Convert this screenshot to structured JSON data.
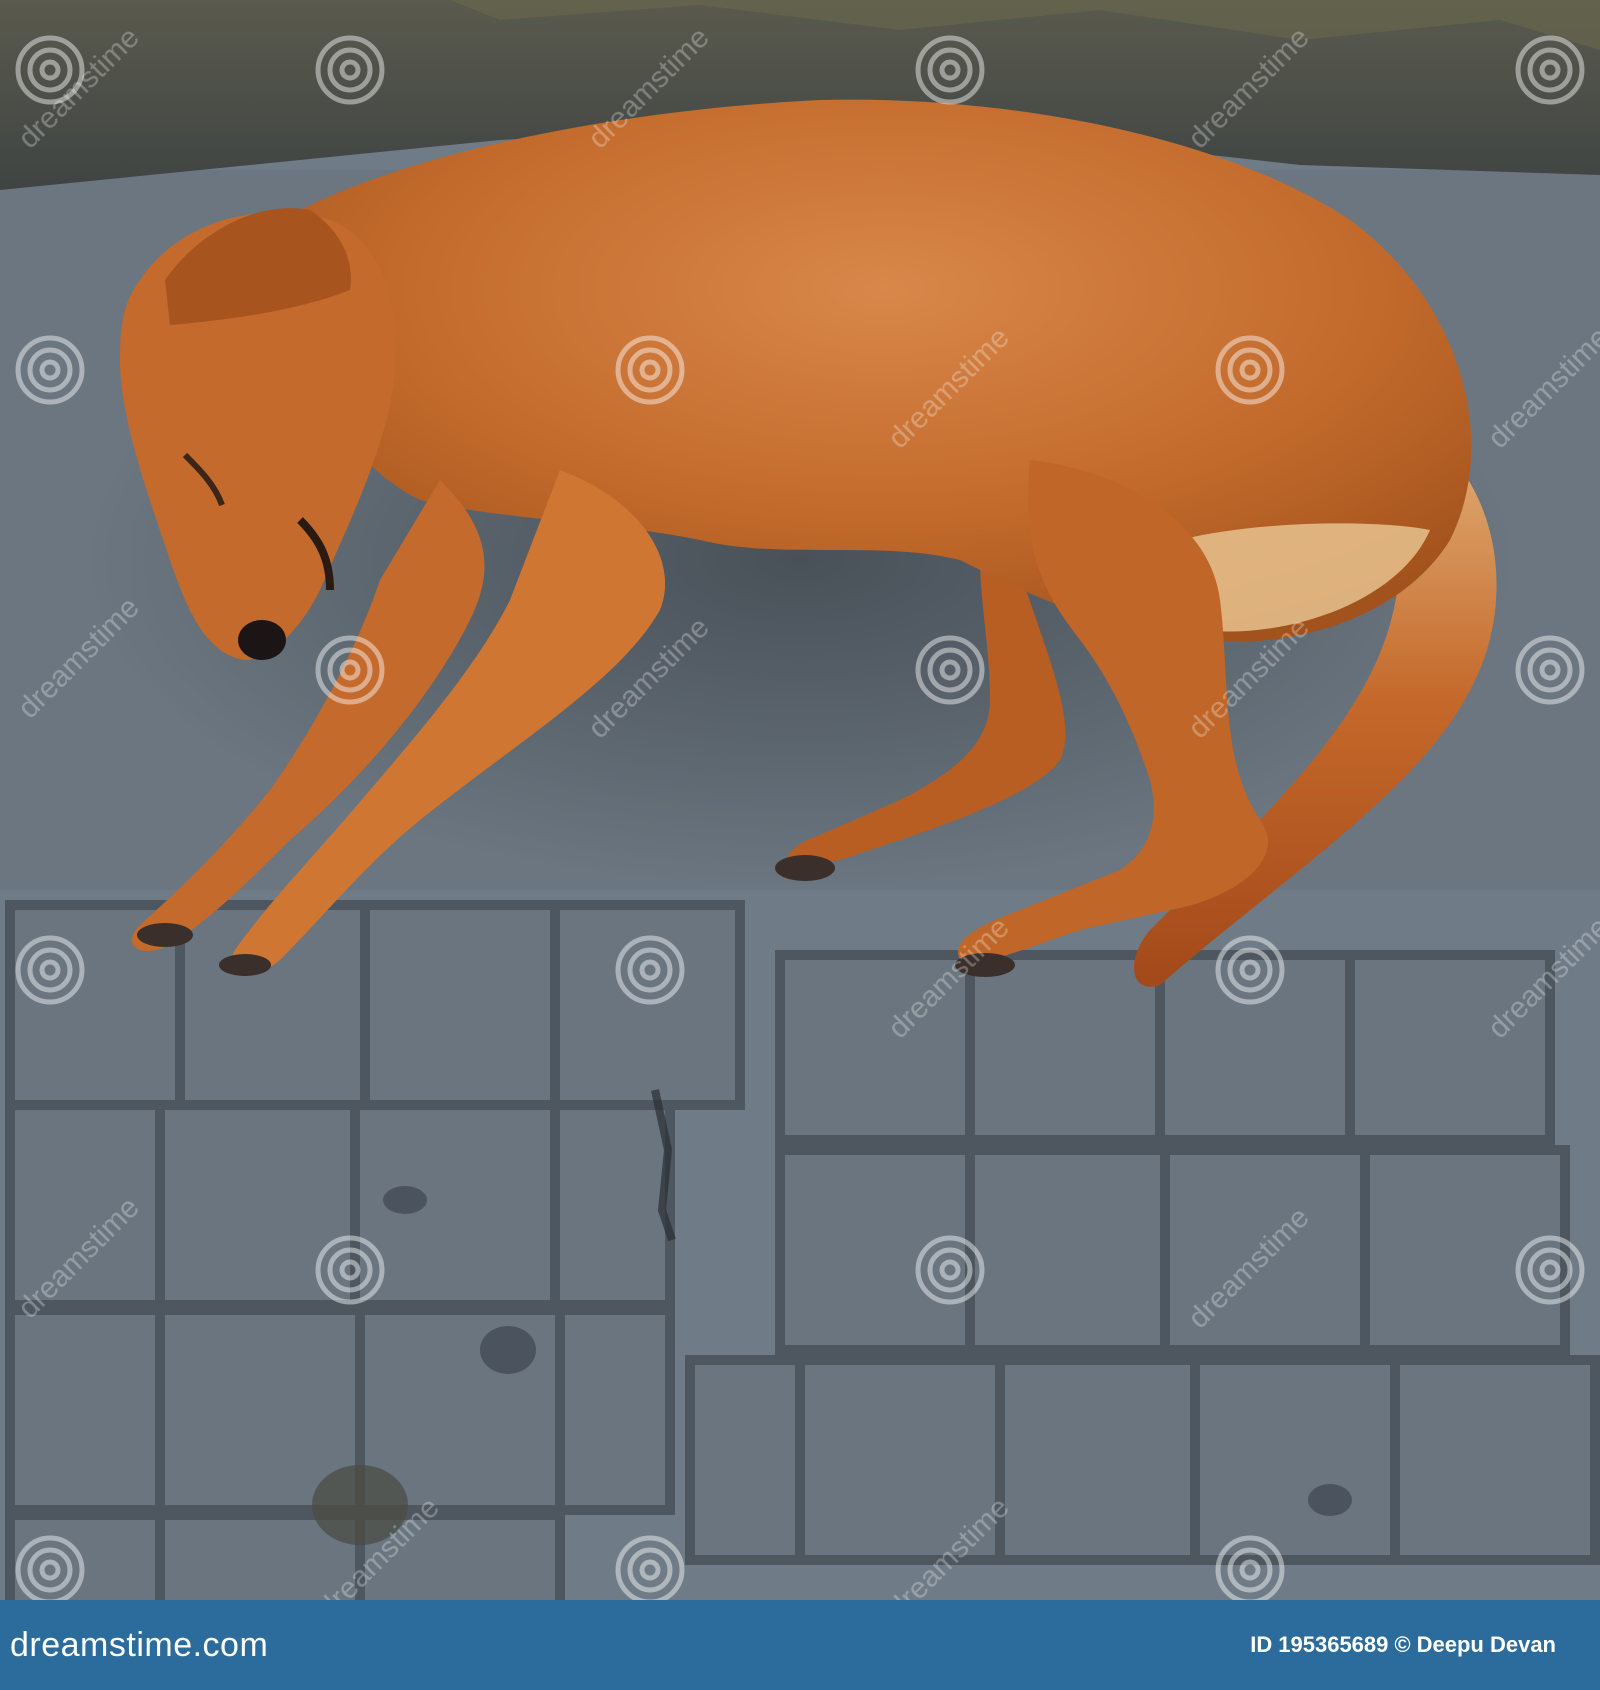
{
  "photo": {
    "subject": "dog-sleeping-on-pavement"
  },
  "watermark": {
    "text": "dreamstime"
  },
  "footer": {
    "brand": "dreamstime.com",
    "id_label": "ID",
    "id_value": "195365689",
    "copyright_symbol": "©",
    "author": "Deepu Devan"
  },
  "colors": {
    "footer_bg": "#2b6c9d",
    "fur": "#c26a2c",
    "pavement": "#6f7b86"
  }
}
